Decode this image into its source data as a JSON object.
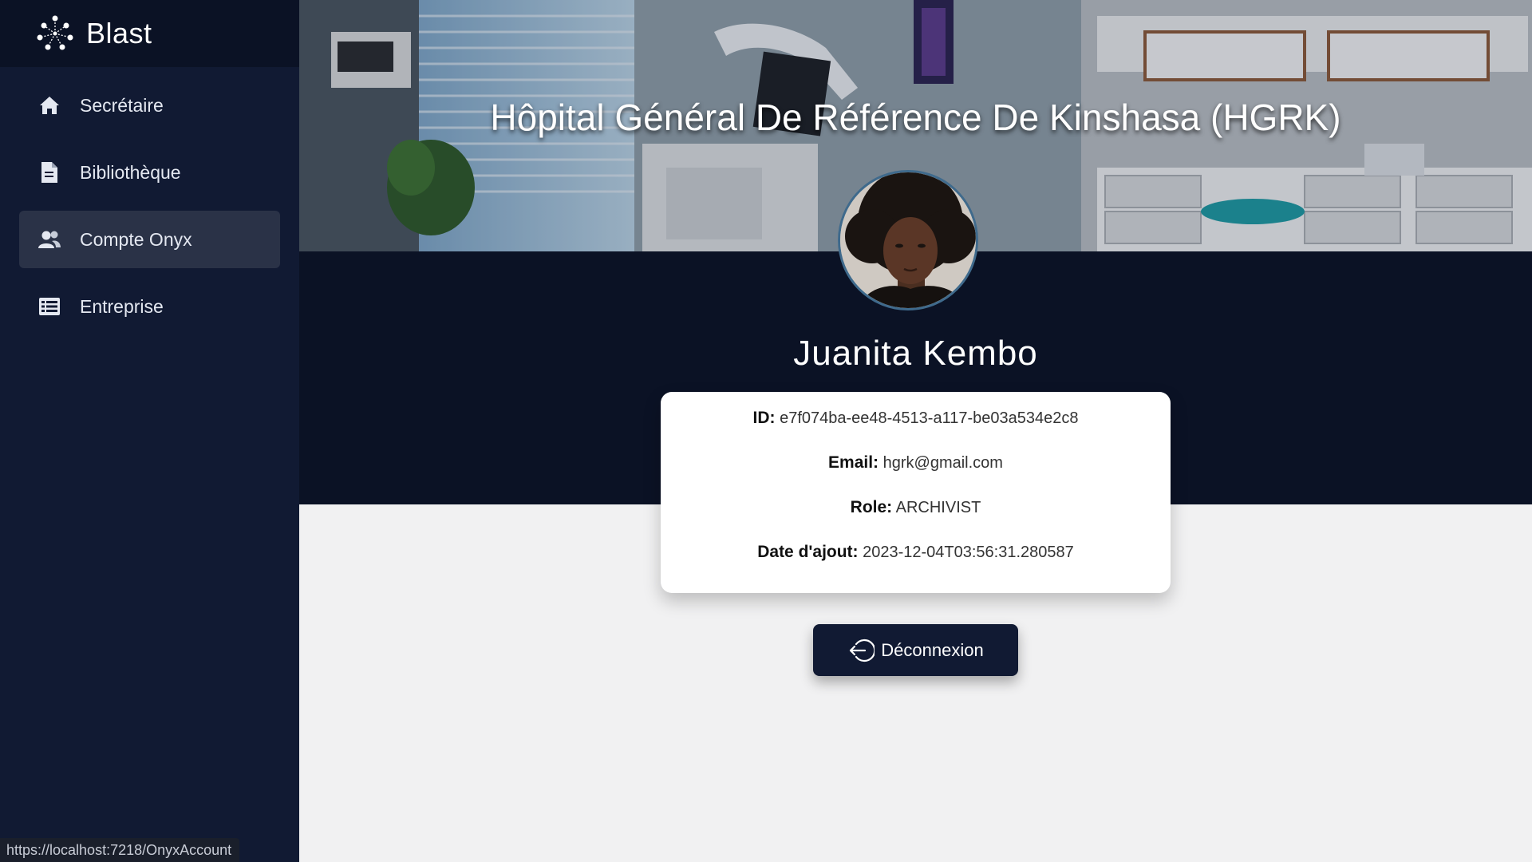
{
  "app": {
    "brand_name": "Blast"
  },
  "sidebar": {
    "items": [
      {
        "label": "Secrétaire",
        "icon": "home-icon",
        "active": false
      },
      {
        "label": "Bibliothèque",
        "icon": "document-icon",
        "active": false
      },
      {
        "label": "Compte Onyx",
        "icon": "users-icon",
        "active": true
      },
      {
        "label": "Entreprise",
        "icon": "list-icon",
        "active": false
      }
    ]
  },
  "profile": {
    "hospital_name": "Hôpital Général De Référence De Kinshasa (HGRK)",
    "user_name": "Juanita Kembo",
    "fields": [
      {
        "key": "ID:",
        "value": "e7f074ba-ee48-4513-a117-be03a534e2c8"
      },
      {
        "key": "Email:",
        "value": "hgrk@gmail.com"
      },
      {
        "key": "Role:",
        "value": "ARCHIVIST"
      },
      {
        "key": "Date d'ajout:",
        "value": "2023-12-04T03:56:31.280587"
      }
    ],
    "logout_label": "Déconnexion"
  },
  "status_bar": {
    "url": "https://localhost:7218/OnyxAccount"
  },
  "colors": {
    "sidebar_bg": "#111a33",
    "brand_bg": "#0b1225",
    "active_item_bg": "#2a3247",
    "content_bg": "#f1f1f2",
    "button_bg": "#111a33"
  }
}
